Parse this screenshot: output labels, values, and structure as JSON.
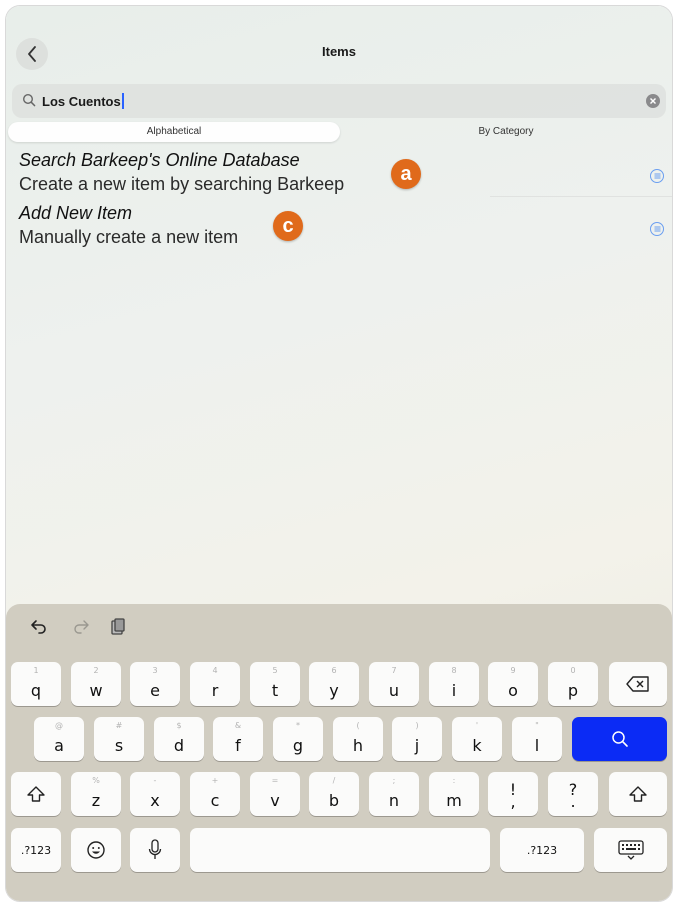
{
  "header": {
    "title": "Items"
  },
  "search": {
    "value": "Los Cuentos"
  },
  "segments": {
    "left": "Alphabetical",
    "right": "By Category"
  },
  "list": [
    {
      "title": "Search Barkeep's Online Database",
      "subtitle": "Create a new item by searching Barkeep",
      "badge": "a"
    },
    {
      "title": "Add New Item",
      "subtitle": "Manually create a new item",
      "badge": "c"
    }
  ],
  "keyboard": {
    "toolbar": [
      "undo-icon",
      "redo-icon",
      "paste-icon"
    ],
    "row1": [
      {
        "hint": "1",
        "key": "q"
      },
      {
        "hint": "2",
        "key": "w"
      },
      {
        "hint": "3",
        "key": "e"
      },
      {
        "hint": "4",
        "key": "r"
      },
      {
        "hint": "5",
        "key": "t"
      },
      {
        "hint": "6",
        "key": "y"
      },
      {
        "hint": "7",
        "key": "u"
      },
      {
        "hint": "8",
        "key": "i"
      },
      {
        "hint": "9",
        "key": "o"
      },
      {
        "hint": "0",
        "key": "p"
      }
    ],
    "row2": [
      {
        "hint": "@",
        "key": "a"
      },
      {
        "hint": "#",
        "key": "s"
      },
      {
        "hint": "$",
        "key": "d"
      },
      {
        "hint": "&",
        "key": "f"
      },
      {
        "hint": "*",
        "key": "g"
      },
      {
        "hint": "(",
        "key": "h"
      },
      {
        "hint": ")",
        "key": "j"
      },
      {
        "hint": "'",
        "key": "k"
      },
      {
        "hint": "\"",
        "key": "l"
      }
    ],
    "row3": [
      {
        "hint": "%",
        "key": "z"
      },
      {
        "hint": "-",
        "key": "x"
      },
      {
        "hint": "+",
        "key": "c"
      },
      {
        "hint": "=",
        "key": "v"
      },
      {
        "hint": "/",
        "key": "b"
      },
      {
        "hint": ";",
        "key": "n"
      },
      {
        "hint": ":",
        "key": "m"
      },
      {
        "hint": "",
        "key": "!\n,"
      },
      {
        "hint": "",
        "key": "?\n."
      }
    ],
    "numbers_label": ".?123",
    "numbers_label_right": ".?123"
  },
  "colors": {
    "badge": "#e06a1b",
    "search_key": "#0b2bf5",
    "info_icon": "#6a9ef0"
  }
}
